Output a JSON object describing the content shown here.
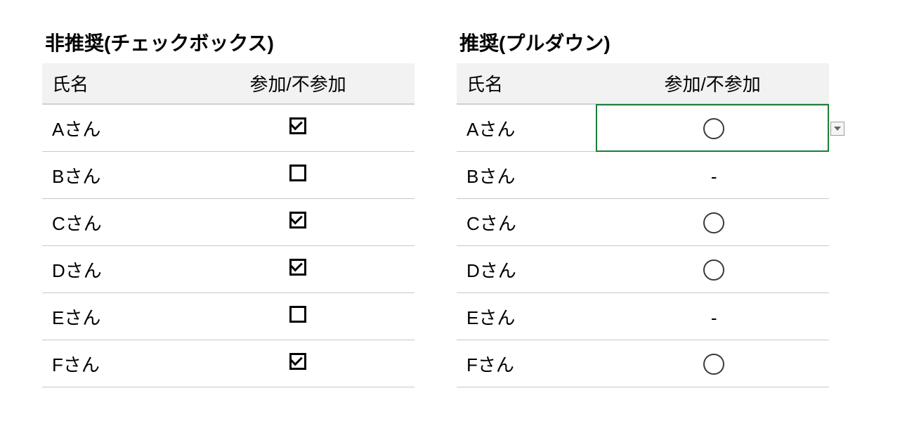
{
  "left": {
    "title": "非推奨(チェックボックス)",
    "headers": {
      "name": "氏名",
      "status": "参加/不参加"
    },
    "rows": [
      {
        "name": "Aさん",
        "checked": true
      },
      {
        "name": "Bさん",
        "checked": false
      },
      {
        "name": "Cさん",
        "checked": true
      },
      {
        "name": "Dさん",
        "checked": true
      },
      {
        "name": "Eさん",
        "checked": false
      },
      {
        "name": "Fさん",
        "checked": true
      }
    ]
  },
  "right": {
    "title": "推奨(プルダウン)",
    "headers": {
      "name": "氏名",
      "status": "参加/不参加"
    },
    "selected_row": 0,
    "rows": [
      {
        "name": "Aさん",
        "value": "○"
      },
      {
        "name": "Bさん",
        "value": "-"
      },
      {
        "name": "Cさん",
        "value": "○"
      },
      {
        "name": "Dさん",
        "value": "○"
      },
      {
        "name": "Eさん",
        "value": "-"
      },
      {
        "name": "Fさん",
        "value": "○"
      }
    ]
  }
}
